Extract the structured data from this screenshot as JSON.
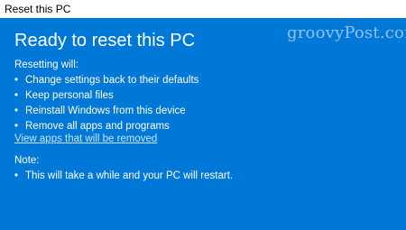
{
  "window": {
    "title": "Reset this PC"
  },
  "watermark": "groovyPost.com",
  "main": {
    "heading": "Ready to reset this PC",
    "resetting_label": "Resetting will:",
    "items": [
      "Change settings back to their defaults",
      "Keep personal files",
      "Reinstall Windows from this device",
      "Remove all apps and programs"
    ],
    "apps_link": "View apps that will be removed",
    "note_label": "Note:",
    "notes": [
      "This will take a while and your PC will restart."
    ],
    "bullet": "•"
  },
  "colors": {
    "background": "#0078d7",
    "titlebar": "#ffffff",
    "text": "#ffffff",
    "link": "#cce4ff"
  }
}
